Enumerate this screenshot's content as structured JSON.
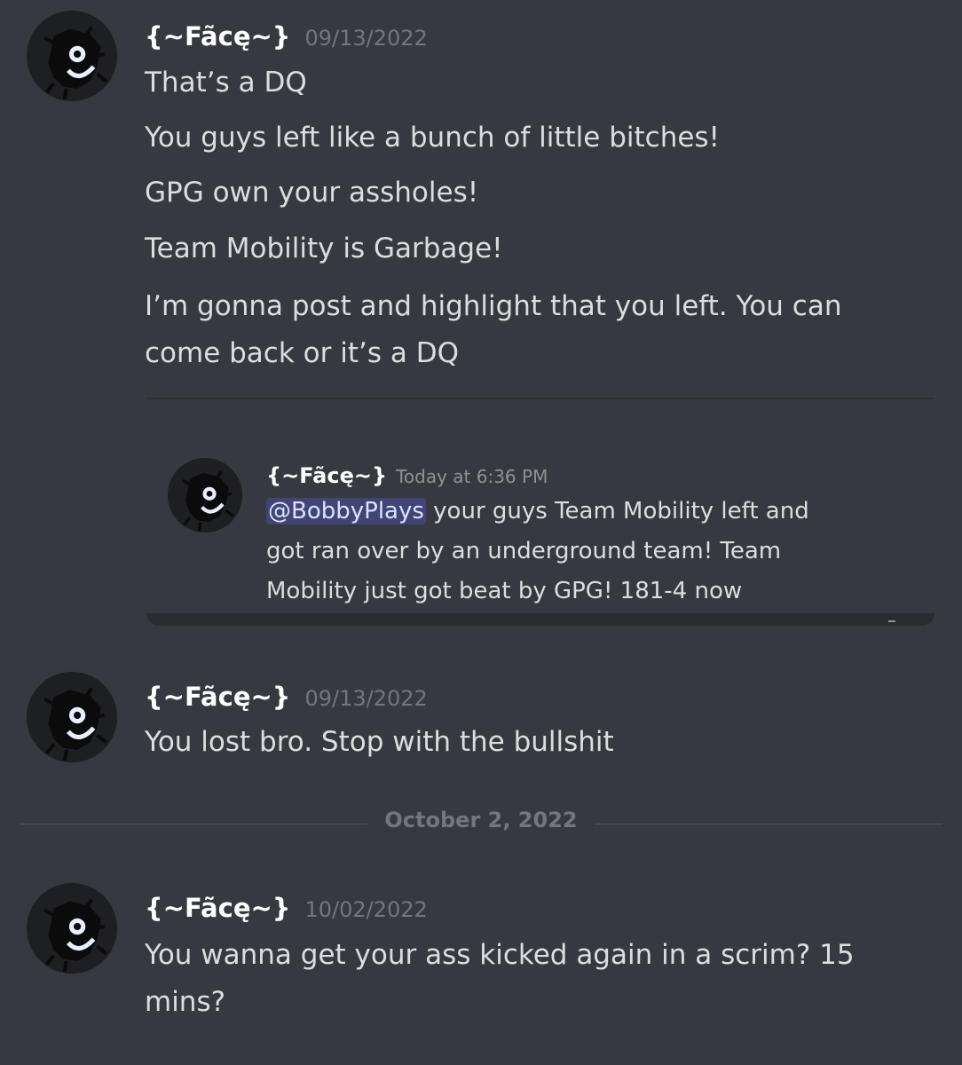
{
  "messages": [
    {
      "username": "{~Fãcę~}",
      "timestamp": "09/13/2022",
      "lines": [
        "That’s a DQ",
        "You guys left like a bunch of little bitches!",
        "GPG own your assholes!",
        "Team Mobility is Garbage!",
        "I’m gonna post and highlight that you left. You can",
        "come back or it’s a DQ"
      ],
      "embed": {
        "username": "{~Fãcę~}",
        "timestamp": "Today at 6:36 PM",
        "mention": "@BobbyPlays",
        "line1_rest": " your guys Team Mobility left and",
        "line2": "got ran over by an underground team! Team",
        "line3": "Mobility just got beat by GPG! 181-4 now"
      }
    },
    {
      "username": "{~Fãcę~}",
      "timestamp": "09/13/2022",
      "lines": [
        "You lost bro. Stop with the bullshit"
      ]
    },
    {
      "username": "{~Fãcę~}",
      "timestamp": "10/02/2022",
      "lines": [
        "You wanna get your ass kicked again in a scrim? 15",
        "mins?"
      ]
    }
  ],
  "date_divider": "October 2, 2022",
  "colors": {
    "background": "#36393f",
    "username": "#ffffff",
    "timestamp": "#72767d",
    "text": "#dcddde",
    "mention_bg": "#5865f24d"
  }
}
